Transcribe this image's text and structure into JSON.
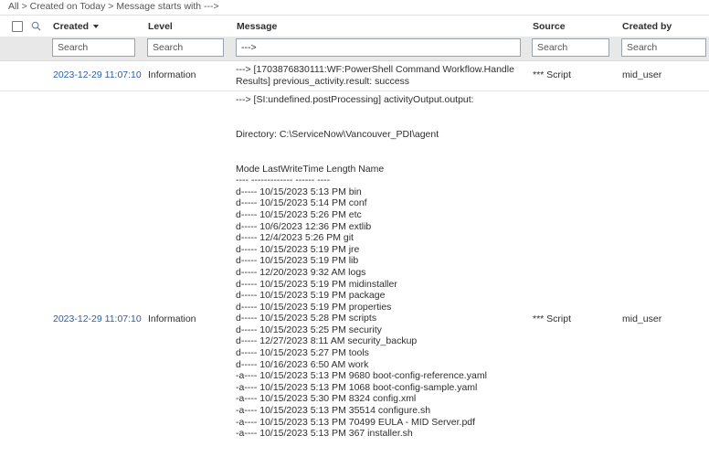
{
  "breadcrumb": {
    "items": [
      "All",
      "Created on Today",
      "Message starts with --->"
    ],
    "separator": ">"
  },
  "columns": {
    "created": "Created",
    "level": "Level",
    "message": "Message",
    "source": "Source",
    "created_by": "Created by"
  },
  "filters": {
    "created_placeholder": "Search",
    "level_placeholder": "Search",
    "message_value": "--->",
    "source_placeholder": "Search",
    "created_by_placeholder": "Search"
  },
  "rows": [
    {
      "created": "2023-12-29 11:07:10",
      "level": "Information",
      "message_lines": [
        "---> [1703876830111:WF:PowerShell Command Workflow.Handle",
        "Results] previous_activity.result: success"
      ],
      "source": "*** Script",
      "created_by": "mid_user"
    },
    {
      "created": "2023-12-29 11:07:10",
      "level": "Information",
      "message_lines": [
        "---> [SI:undefined.postProcessing] activityOutput.output:",
        "",
        "",
        "Directory: C:\\ServiceNow\\Vancouver_PDI\\agent",
        "",
        "",
        "Mode LastWriteTime Length Name",
        "---- ------------- ------ ----",
        "d----- 10/15/2023 5:13 PM bin",
        "d----- 10/15/2023 5:14 PM conf",
        "d----- 10/15/2023 5:26 PM etc",
        "d----- 10/6/2023 12:36 PM extlib",
        "d----- 12/4/2023 5:26 PM git",
        "d----- 10/15/2023 5:19 PM jre",
        "d----- 10/15/2023 5:19 PM lib",
        "d----- 12/20/2023 9:32 AM logs",
        "d----- 10/15/2023 5:19 PM midinstaller",
        "d----- 10/15/2023 5:19 PM package",
        "d----- 10/15/2023 5:19 PM properties",
        "d----- 10/15/2023 5:28 PM scripts",
        "d----- 10/15/2023 5:25 PM security",
        "d----- 12/27/2023 8:11 AM security_backup",
        "d----- 10/15/2023 5:27 PM tools",
        "d----- 10/16/2023 6:50 AM work",
        "-a---- 10/15/2023 5:13 PM 9680 boot-config-reference.yaml",
        "-a---- 10/15/2023 5:13 PM 1068 boot-config-sample.yaml",
        "-a---- 10/15/2023 5:30 PM 8324 config.xml",
        "-a---- 10/15/2023 5:13 PM 35514 configure.sh",
        "-a---- 10/15/2023 5:13 PM 70499 EULA - MID Server.pdf",
        "-a---- 10/15/2023 5:13 PM 367 installer.sh"
      ],
      "source": "*** Script",
      "created_by": "mid_user"
    }
  ]
}
